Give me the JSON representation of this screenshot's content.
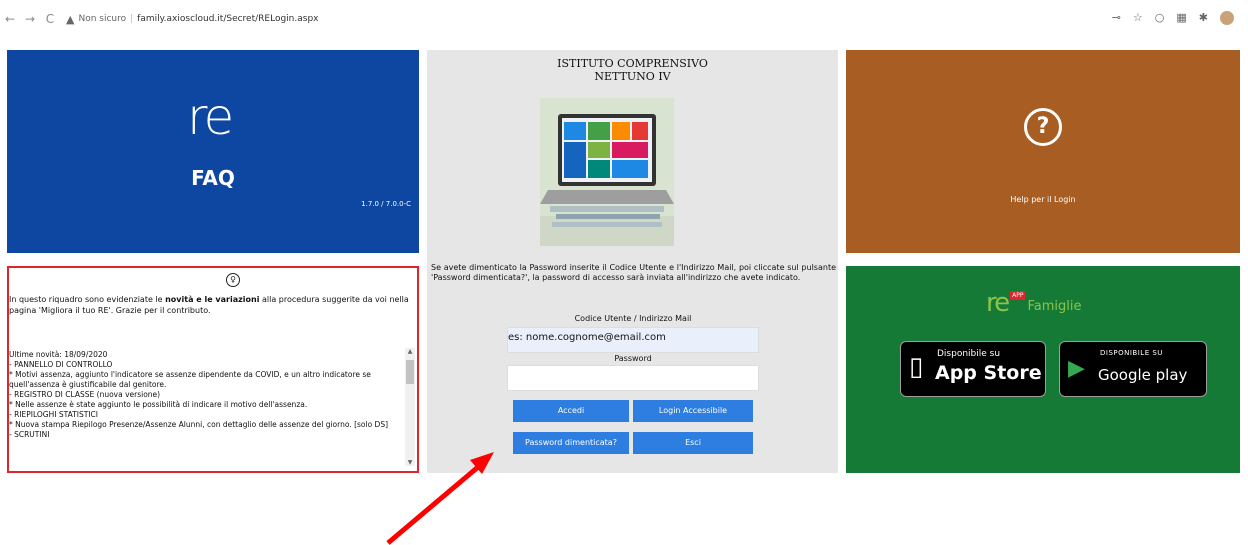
{
  "browser": {
    "back": "←",
    "forward": "→",
    "reload": "C",
    "not_secure": "Non sicuro",
    "separator": "|",
    "url": "family.axioscloud.it/Secret/RELogin.aspx"
  },
  "faq_tile": {
    "logo": "re",
    "label": "FAQ",
    "version": "1.7.0 / 7.0.0-C",
    "color": "#0d47a1"
  },
  "login_tile": {
    "school_line1": "ISTITUTO COMPRENSIVO",
    "school_line2": "NETTUNO IV",
    "info": "Se avete dimenticato la Password inserite il Codice Utente e l'Indirizzo Mail, poi cliccate sul pulsante 'Password dimenticata?', la password di accesso sarà inviata all'indirizzo che avete indicato.",
    "user_label": "Codice Utente / Indirizzo Mail",
    "user_value": "es: nome.cognome@email.com",
    "password_label": "Password",
    "password_value": "",
    "btn_accedi": "Accedi",
    "btn_accessible": "Login Accessibile",
    "btn_forgot": "Password dimenticata?",
    "btn_esci": "Esci",
    "button_color": "#2d7ee0"
  },
  "help_tile": {
    "icon": "?",
    "label": "Help per il Login",
    "color": "#a85d22"
  },
  "news_tile": {
    "intro_1": "In questo riquadro sono evidenziate le ",
    "intro_bold": "novità e le variazioni",
    "intro_2": " alla procedura suggerite da voi nella pagina 'Migliora il tuo RE'. Grazie per il contributo.",
    "lines": [
      "Ultime novità: 18/09/2020",
      "- PANNELLO DI CONTROLLO",
      "  * Motivi assenza, aggiunto l'indicatore se assenze dipendente da COVID, e un altro indicatore se quell'assenza è giustificabile dal genitore.",
      "  - REGISTRO DI CLASSE (nuova versione)",
      "  * Nelle assenze è state aggiunto le possibilità di indicare il motivo dell'assenza.",
      "- RIEPILOGHI STATISTICI",
      "  * Nuova stampa Riepilogo Presenze/Assenze Alunni, con dettaglio delle assenze del giorno. [solo DS]",
      "- SCRUTINI"
    ],
    "border_color": "#e0262c"
  },
  "app_tile": {
    "logo": "re",
    "badge": "APP",
    "title": "Famiglie",
    "appstore_small": "Disponibile su",
    "appstore_big": "App Store",
    "googleplay_small": "DISPONIBILE SU",
    "googleplay_big": "Google play",
    "color": "#157a36"
  },
  "annotation": {
    "arrow_color": "#ff0000"
  }
}
